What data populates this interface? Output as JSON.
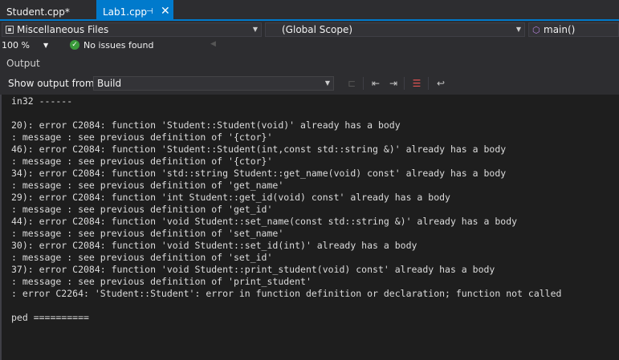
{
  "tabs": [
    {
      "label": "Student.cpp*",
      "active": false
    },
    {
      "label": "Lab1.cpp",
      "active": true,
      "pin_icon": "pin-icon",
      "close_icon": "close-icon"
    }
  ],
  "navbar": {
    "project": "Miscellaneous Files",
    "scope": "(Global Scope)",
    "member": "main()"
  },
  "status": {
    "zoom": "100 %",
    "issues": "No issues found"
  },
  "output_pane": {
    "title": "Output",
    "show_output_from_label": "Show output from:",
    "source": "Build",
    "toolbar_icons": [
      "find-message-icon",
      "go-to-previous-message-icon",
      "go-to-next-message-icon",
      "clear-all-icon",
      "toggle-word-wrap-icon"
    ]
  },
  "output_lines": [
    "in32 ------",
    "",
    "20): error C2084: function 'Student::Student(void)' already has a body",
    ": message : see previous definition of '{ctor}'",
    "46): error C2084: function 'Student::Student(int,const std::string &)' already has a body",
    ": message : see previous definition of '{ctor}'",
    "34): error C2084: function 'std::string Student::get_name(void) const' already has a body",
    ": message : see previous definition of 'get_name'",
    "29): error C2084: function 'int Student::get_id(void) const' already has a body",
    ": message : see previous definition of 'get_id'",
    "44): error C2084: function 'void Student::set_name(const std::string &)' already has a body",
    ": message : see previous definition of 'set_name'",
    "30): error C2084: function 'void Student::set_id(int)' already has a body",
    ": message : see previous definition of 'set_id'",
    "37): error C2084: function 'void Student::print_student(void) const' already has a body",
    ": message : see previous definition of 'print_student'",
    ": error C2264: 'Student::Student': error in function definition or declaration; function not called",
    "",
    "ped =========="
  ],
  "colors": {
    "accent": "#007acc",
    "background": "#1e1e1e",
    "chrome": "#2d2d30",
    "success": "#3a9a3a"
  }
}
